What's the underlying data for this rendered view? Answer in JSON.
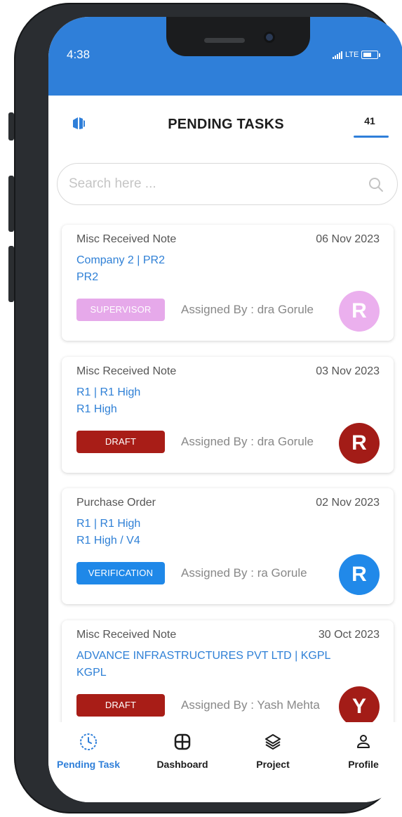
{
  "status_bar": {
    "time": "4:38",
    "network": "LTE"
  },
  "header": {
    "title": "PENDING TASKS",
    "count": "41"
  },
  "search": {
    "placeholder": "Search here ..."
  },
  "tasks": [
    {
      "type": "Misc Received Note",
      "date": "06 Nov 2023",
      "line1": "Company 2 | PR2",
      "line2": "PR2",
      "status": "SUPERVISOR",
      "status_color": "#e6a9ea",
      "assigned_label": "Assigned By :",
      "assigned_name": "dra Gorule",
      "avatar_letter": "R",
      "avatar_color": "#ebb0ee"
    },
    {
      "type": "Misc Received Note",
      "date": "03 Nov 2023",
      "line1": "R1 | R1 High",
      "line2": "R1 High",
      "status": "DRAFT",
      "status_color": "#a81d17",
      "assigned_label": "Assigned By :",
      "assigned_name": "dra Gorule",
      "avatar_letter": "R",
      "avatar_color": "#a31c17"
    },
    {
      "type": "Purchase Order",
      "date": "02 Nov 2023",
      "line1": "R1 | R1 High",
      "line2": "R1 High / V4",
      "status": "VERIFICATION",
      "status_color": "#1f88e8",
      "assigned_label": "Assigned By :",
      "assigned_name": "ra Gorule",
      "avatar_letter": "R",
      "avatar_color": "#2189e9"
    },
    {
      "type": "Misc Received Note",
      "date": "30 Oct 2023",
      "line1": "ADVANCE INFRASTRUCTURES PVT LTD | KGPL",
      "line2": "KGPL",
      "status": "DRAFT",
      "status_color": "#a81d17",
      "assigned_label": "Assigned By :",
      "assigned_name": "Yash Mehta",
      "avatar_letter": "Y",
      "avatar_color": "#a31c17"
    }
  ],
  "bottom_nav": [
    {
      "label": "Pending Task",
      "icon": "clock-icon",
      "active": true
    },
    {
      "label": "Dashboard",
      "icon": "grid-icon",
      "active": false
    },
    {
      "label": "Project",
      "icon": "layers-icon",
      "active": false
    },
    {
      "label": "Profile",
      "icon": "user-icon",
      "active": false
    }
  ],
  "colors": {
    "accent": "#2f7fd9",
    "status_bar": "#2f7fd9"
  }
}
